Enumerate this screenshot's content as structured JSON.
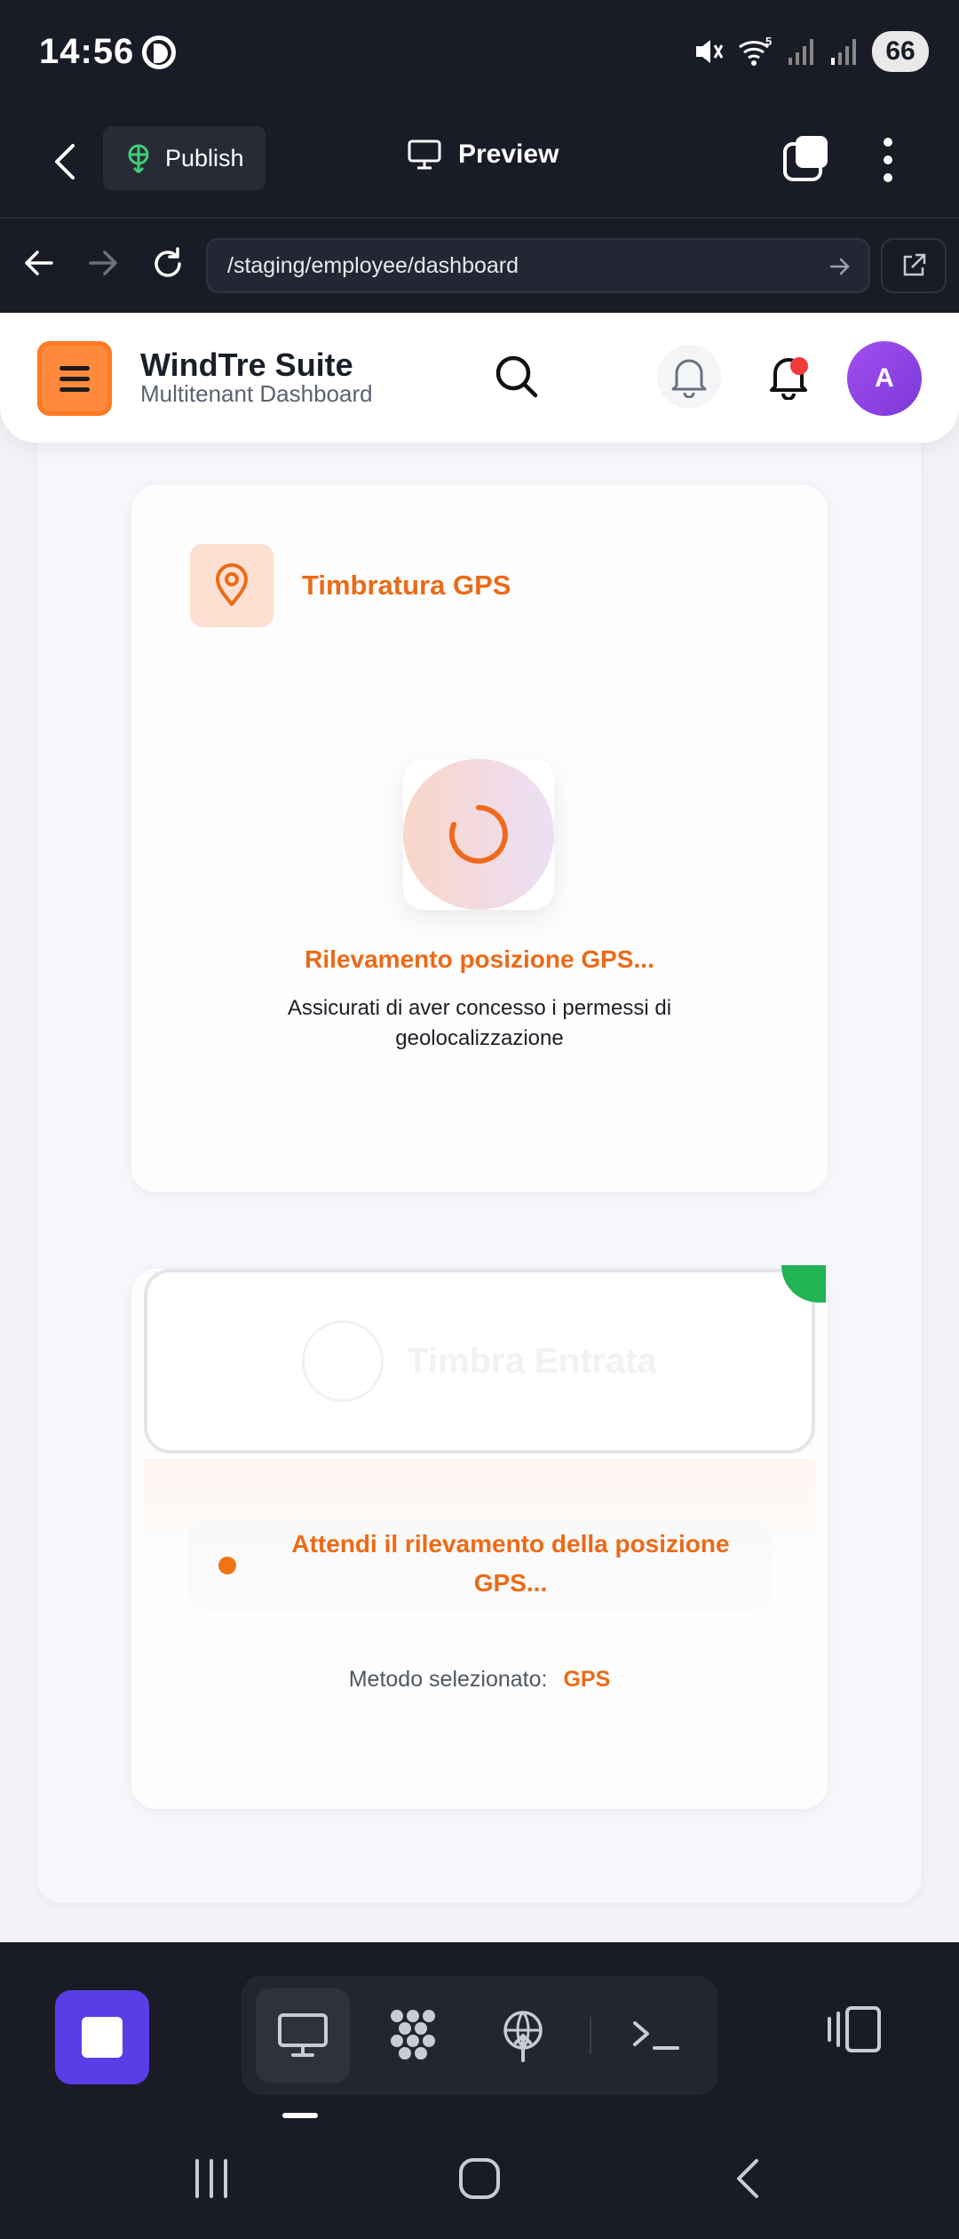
{
  "status_bar": {
    "time": "14:56",
    "battery": "66",
    "wifi_badge": "5"
  },
  "editor_bar": {
    "publish_label": "Publish",
    "preview_label": "Preview"
  },
  "browser": {
    "url": "/staging/employee/dashboard"
  },
  "app_header": {
    "title": "WindTre Suite",
    "subtitle": "Multitenant Dashboard",
    "avatar_initial": "A"
  },
  "gps_card": {
    "title": "Timbratura GPS",
    "status_title": "Rilevamento posizione GPS...",
    "status_subtitle": "Assicurati di aver concesso i permessi di geolocalizzazione"
  },
  "action_card": {
    "stamp_button_label": "Timbra Entrata",
    "wait_message": "Attendi il rilevamento della posizione GPS...",
    "method_label": "Metodo selezionato:",
    "method_value": "GPS"
  },
  "colors": {
    "accent": "#ec6a16",
    "editor_bg": "#191c26",
    "stop_button": "#5a3de6",
    "avatar": "#9a48ec",
    "online_dot": "#21b354",
    "notification_dot": "#ef3b3b"
  },
  "icons": [
    "back-icon",
    "publish-icon",
    "monitor-icon",
    "tabs-icon",
    "more-icon",
    "arrow-left-icon",
    "arrow-right-icon",
    "reload-icon",
    "open-external-icon",
    "menu-icon",
    "search-icon",
    "bell-icon",
    "map-pin-icon",
    "spinner-icon",
    "stop-icon",
    "desktop-icon",
    "apps-icon",
    "deploy-icon",
    "terminal-icon",
    "device-icon"
  ]
}
